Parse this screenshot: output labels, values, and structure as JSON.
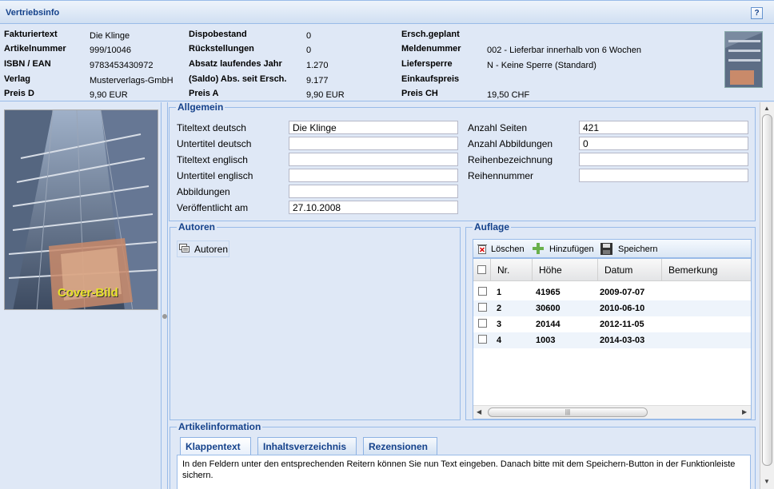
{
  "header": {
    "title": "Vertriebsinfo",
    "help": "?"
  },
  "info": {
    "col1": [
      {
        "label": "Fakturiertext",
        "value": "Die Klinge"
      },
      {
        "label": "Artikelnummer",
        "value": "999/10046"
      },
      {
        "label": "ISBN / EAN",
        "value": "9783453430972"
      },
      {
        "label": "Verlag",
        "value": "Musterverlags-GmbH"
      },
      {
        "label": "Preis D",
        "value": "9,90 EUR"
      }
    ],
    "col2": [
      {
        "label": "Dispobestand",
        "value": "0"
      },
      {
        "label": "Rückstellungen",
        "value": "0"
      },
      {
        "label": "Absatz laufendes Jahr",
        "value": "1.270"
      },
      {
        "label": "(Saldo) Abs. seit Ersch.",
        "value": "9.177"
      },
      {
        "label": "Preis A",
        "value": "9,90 EUR"
      }
    ],
    "col3": [
      {
        "label": "Ersch.geplant",
        "value": ""
      },
      {
        "label": "Meldenummer",
        "value": "002 - Lieferbar innerhalb von 6 Wochen"
      },
      {
        "label": "Liefersperre",
        "value": "N - Keine Sperre (Standard)"
      },
      {
        "label": "Einkaufspreis",
        "value": ""
      },
      {
        "label": "Preis CH",
        "value": "19,50 CHF"
      }
    ]
  },
  "cover": {
    "text": "Cover-Bild"
  },
  "allgemein": {
    "legend": "Allgemein",
    "left": [
      {
        "label": "Titeltext deutsch",
        "value": "Die Klinge"
      },
      {
        "label": "Untertitel deutsch",
        "value": ""
      },
      {
        "label": "Titeltext englisch",
        "value": ""
      },
      {
        "label": "Untertitel englisch",
        "value": ""
      },
      {
        "label": "Abbildungen",
        "value": ""
      },
      {
        "label": "Veröffentlicht am",
        "value": "27.10.2008"
      }
    ],
    "right": [
      {
        "label": "Anzahl Seiten",
        "value": "421"
      },
      {
        "label": "Anzahl Abbildungen",
        "value": "0"
      },
      {
        "label": "Reihenbezeichnung",
        "value": ""
      },
      {
        "label": "Reihennummer",
        "value": ""
      }
    ]
  },
  "autoren": {
    "legend": "Autoren",
    "item": "Autoren"
  },
  "auflage": {
    "legend": "Auflage",
    "toolbar": {
      "delete": "Löschen",
      "add": "Hinzufügen",
      "save": "Speichern"
    },
    "columns": [
      "Nr.",
      "Höhe",
      "Datum",
      "Bemerkung"
    ],
    "rows": [
      {
        "nr": "1",
        "hoehe": "41965",
        "datum": "2009-07-07",
        "bemerkung": ""
      },
      {
        "nr": "2",
        "hoehe": "30600",
        "datum": "2010-06-10",
        "bemerkung": ""
      },
      {
        "nr": "3",
        "hoehe": "20144",
        "datum": "2012-11-05",
        "bemerkung": ""
      },
      {
        "nr": "4",
        "hoehe": "1003",
        "datum": "2014-03-03",
        "bemerkung": ""
      }
    ]
  },
  "artikelinfo": {
    "legend": "Artikelinformation",
    "tabs": [
      "Klappentext",
      "Inhaltsverzeichnis",
      "Rezensionen"
    ],
    "content": "In den Feldern unter den entsprechenden Reitern können Sie nun Text eingeben. Danach bitte mit dem Speichern-Button in der Funktionleiste sichern."
  }
}
